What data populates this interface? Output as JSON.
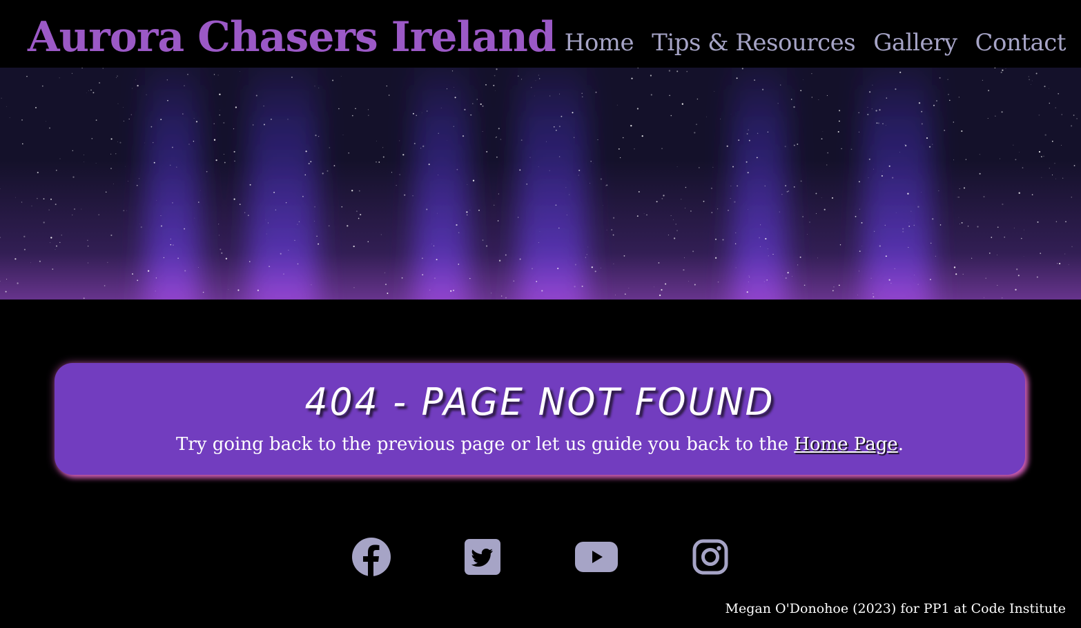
{
  "header": {
    "title": "Aurora Chasers Ireland",
    "nav": [
      {
        "label": "Home"
      },
      {
        "label": "Tips & Resources"
      },
      {
        "label": "Gallery"
      },
      {
        "label": "Contact"
      }
    ]
  },
  "hero": {
    "icon": "aurora-night-sky-banner"
  },
  "error_card": {
    "heading": "404 - PAGE NOT FOUND",
    "message_before": "Try going back to the previous page or let us guide you back to the ",
    "link_label": "Home Page",
    "message_after": "."
  },
  "social": [
    {
      "icon": "facebook-icon"
    },
    {
      "icon": "twitter-icon"
    },
    {
      "icon": "youtube-icon"
    },
    {
      "icon": "instagram-icon"
    }
  ],
  "footer": {
    "credit": "Megan O'Donohoe (2023) for PP1 at Code Institute"
  },
  "colors": {
    "title": "#9b59c6",
    "nav": "#a6a4c6",
    "card": "#723dbf",
    "card_glow": "#d35fb9",
    "social_icons": "#a6a4c6"
  }
}
